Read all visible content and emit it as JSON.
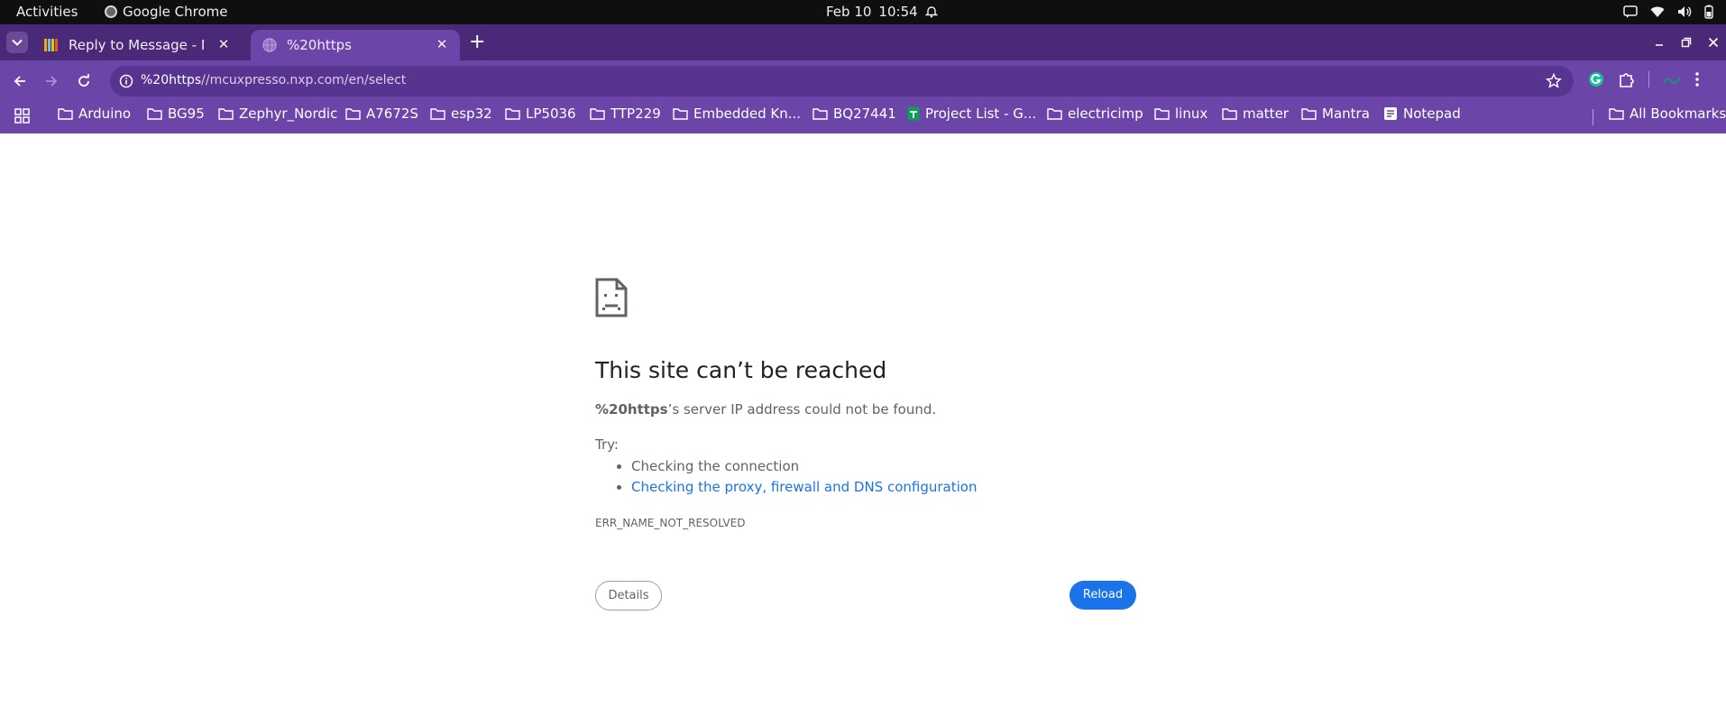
{
  "system_bar": {
    "activities_label": "Activities",
    "app_name": "Google Chrome",
    "date": "Feb 10",
    "time": "10:54"
  },
  "browser": {
    "tabs": [
      {
        "title": "Reply to Message - NXP",
        "state": "inactive",
        "favicon": "nxp-community-icon"
      },
      {
        "title": "%20https",
        "state": "active",
        "favicon": "globe-icon"
      }
    ],
    "url": {
      "host": "%20https",
      "path": "//mcuxpresso.nxp.com/en/select"
    },
    "bookmarks": [
      {
        "label": "Arduino",
        "icon": "folder-icon"
      },
      {
        "label": "BG95",
        "icon": "folder-icon"
      },
      {
        "label": "Zephyr_Nordic",
        "icon": "folder-icon"
      },
      {
        "label": "A7672S",
        "icon": "folder-icon"
      },
      {
        "label": "esp32",
        "icon": "folder-icon"
      },
      {
        "label": "LP5036",
        "icon": "folder-icon"
      },
      {
        "label": "TTP229",
        "icon": "folder-icon"
      },
      {
        "label": "Embedded Kn...",
        "icon": "folder-icon"
      },
      {
        "label": "BQ27441",
        "icon": "folder-icon"
      },
      {
        "label": "Project List - G...",
        "icon": "sheets-icon"
      },
      {
        "label": "electricimp",
        "icon": "folder-icon"
      },
      {
        "label": "linux",
        "icon": "folder-icon"
      },
      {
        "label": "matter",
        "icon": "folder-icon"
      },
      {
        "label": "Mantra",
        "icon": "folder-icon"
      },
      {
        "label": "Notepad",
        "icon": "notepad-icon"
      }
    ],
    "all_bookmarks_label": "All Bookmarks"
  },
  "error_page": {
    "title": "This site can’t be reached",
    "host_bold": "%20https",
    "host_suffix": "’s server IP address could not be found.",
    "try_label": "Try:",
    "suggestions": [
      {
        "text": "Checking the connection",
        "link": false
      },
      {
        "text": "Checking the proxy, firewall and DNS configuration",
        "link": true
      }
    ],
    "error_code": "ERR_NAME_NOT_RESOLVED",
    "details_button": "Details",
    "reload_button": "Reload"
  },
  "colors": {
    "tabstrip": "#4a2a78",
    "toolbar": "#6b46a8",
    "link": "#1a73e8",
    "reload_button": "#1a73e8"
  }
}
